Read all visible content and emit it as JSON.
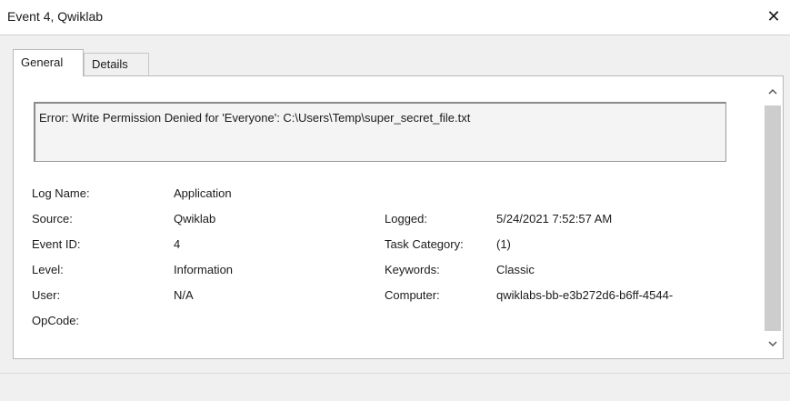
{
  "window": {
    "title": "Event 4, Qwiklab",
    "close_symbol": "✕"
  },
  "tabs": [
    {
      "label": "General",
      "active": true
    },
    {
      "label": "Details",
      "active": false
    }
  ],
  "event": {
    "message": "Error: Write Permission Denied for 'Everyone': C:\\Users\\Temp\\super_secret_file.txt",
    "left": [
      {
        "label": "Log Name:",
        "value": "Application"
      },
      {
        "label": "Source:",
        "value": "Qwiklab"
      },
      {
        "label": "Event ID:",
        "value": "4"
      },
      {
        "label": "Level:",
        "value": "Information"
      },
      {
        "label": "User:",
        "value": "N/A"
      },
      {
        "label": "OpCode:",
        "value": ""
      }
    ],
    "right": [
      {
        "label": "Logged:",
        "value": "5/24/2021 7:52:57 AM"
      },
      {
        "label": "Task Category:",
        "value": "(1)"
      },
      {
        "label": "Keywords:",
        "value": "Classic"
      },
      {
        "label": "Computer:",
        "value": "qwiklabs-bb-e3b272d6-b6ff-4544-"
      }
    ]
  },
  "icons": {
    "scroll_up": "chevron-up-icon",
    "scroll_down": "chevron-down-icon"
  }
}
